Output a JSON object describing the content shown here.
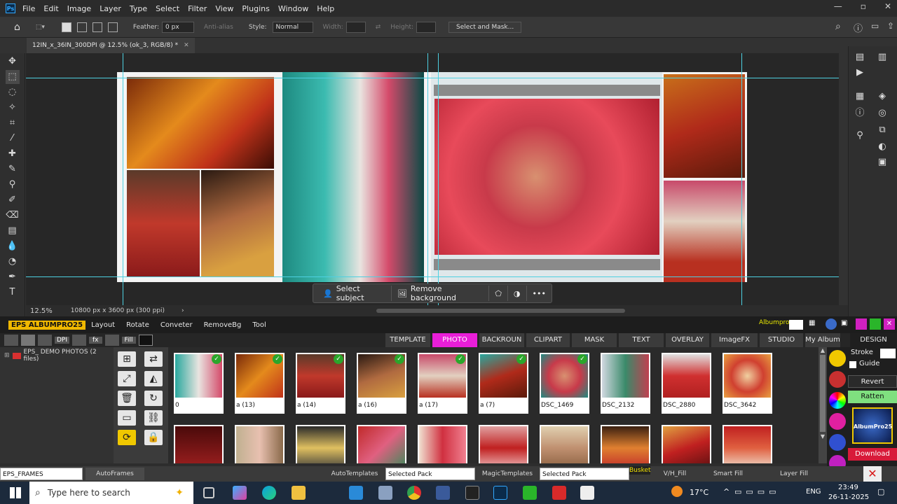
{
  "menubar": {
    "app_icon": "Ps",
    "items": [
      "File",
      "Edit",
      "Image",
      "Layer",
      "Type",
      "Select",
      "Filter",
      "View",
      "Plugins",
      "Window",
      "Help"
    ]
  },
  "options": {
    "feather_label": "Feather:",
    "feather_value": "0 px",
    "antialias": "Anti-alias",
    "style_label": "Style:",
    "style_value": "Normal",
    "width_label": "Width:",
    "height_label": "Height:",
    "select_mask": "Select and Mask..."
  },
  "document": {
    "tab_title": "12IN_x_36IN_300DPI @ 12.5% (ok_3, RGB/8) *"
  },
  "context_bar": {
    "select_subject": "Select subject",
    "remove_background": "Remove background",
    "more": "•••"
  },
  "status": {
    "zoom": "12.5%",
    "doc_size": "10800 px x 3600 px (300 ppi)"
  },
  "plugin": {
    "badge": "EPS ALBUMPRO25",
    "menu": [
      "Layout",
      "Rotate",
      "Conveter",
      "RemoveBg",
      "Tool"
    ],
    "brand": "Albumpro",
    "design_tab": "DESIGN",
    "toolbar_labels": {
      "dpi": "DPI",
      "fx": "fx",
      "fill": "Fill"
    },
    "tabs": [
      "TEMPLATE",
      "PHOTO",
      "BACKROUN",
      "CLIPART",
      "MASK",
      "TEXT",
      "OVERLAY",
      "ImageFX",
      "STUDIO",
      "My Album"
    ],
    "active_tab": "PHOTO",
    "tree_item": "EPS_ DEMO PHOTOS (2 files)",
    "thumbs_row1": [
      "0",
      "a (13)",
      "a (14)",
      "a (16)",
      "a (17)",
      "a (7)",
      "DSC_1469",
      "DSC_2132",
      "DSC_2880",
      "DSC_3642"
    ],
    "thumbs_row1_checked": [
      true,
      true,
      true,
      true,
      true,
      true,
      true,
      false,
      false,
      false
    ],
    "side_labels": {
      "stroke": "Stroke",
      "guide": "Guide",
      "revert": "Revert",
      "ratten": "Ratten",
      "download": "Download",
      "logo": "AlbumPro25"
    }
  },
  "bottombar": {
    "frames_select": "EPS_FRAMES",
    "autoframes": "AutoFrames",
    "autotemplates": "AutoTemplates",
    "selected_pack_1": "Selected Pack",
    "magictemplates": "MagicTemplates",
    "selected_pack_2": "Selected Pack",
    "busket": "Busket",
    "vh_fill": "V/H_Fill",
    "smart_fill": "Smart Fill",
    "layer_fill": "Layer Fill"
  },
  "taskbar": {
    "search_placeholder": "Type here to search",
    "temperature": "17°C",
    "language": "ENG",
    "time": "23:49",
    "date": "26-11-2025"
  },
  "colors": {
    "accent_tab": "#e91ed8",
    "badge": "#f0b800",
    "guide": "#4dd0e1"
  }
}
